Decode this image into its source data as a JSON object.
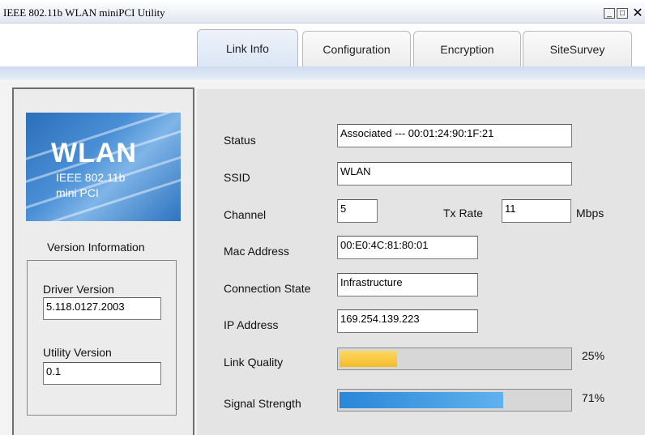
{
  "window": {
    "title": "IEEE 802.11b WLAN miniPCI Utility",
    "minimize_glyph": "_",
    "maximize_glyph": "□",
    "close_glyph": "✕"
  },
  "tabs": [
    {
      "label": "Link Info",
      "active": true
    },
    {
      "label": "Configuration",
      "active": false
    },
    {
      "label": "Encryption",
      "active": false
    },
    {
      "label": "SiteSurvey",
      "active": false
    }
  ],
  "logo": {
    "title": "WLAN",
    "line1": "IEEE 802.11b",
    "line2": "mini PCI"
  },
  "version": {
    "title": "Version Information",
    "driver_label": "Driver Version",
    "driver_value": "5.118.0127.2003",
    "utility_label": "Utility Version",
    "utility_value": "0.1"
  },
  "link_info": {
    "status_label": "Status",
    "status_value": "Associated --- 00:01:24:90:1F:21",
    "ssid_label": "SSID",
    "ssid_value": "WLAN",
    "channel_label": "Channel",
    "channel_value": "5",
    "txrate_label": "Tx Rate",
    "txrate_value": "11",
    "txrate_unit": "Mbps",
    "mac_label": "Mac Address",
    "mac_value": "00:E0:4C:81:80:01",
    "conn_label": "Connection State",
    "conn_value": "Infrastructure",
    "ip_label": "IP Address",
    "ip_value": "169.254.139.223",
    "quality_label": "Link Quality",
    "quality_percent_text": "25%",
    "quality_value": 0.25,
    "signal_label": "Signal Strength",
    "signal_percent_text": "71%",
    "signal_value": 0.71
  },
  "colors": {
    "quality_fill": "#f2bc2a",
    "signal_fill": "#2a86d8",
    "active_tab": "#dbe6f5"
  }
}
